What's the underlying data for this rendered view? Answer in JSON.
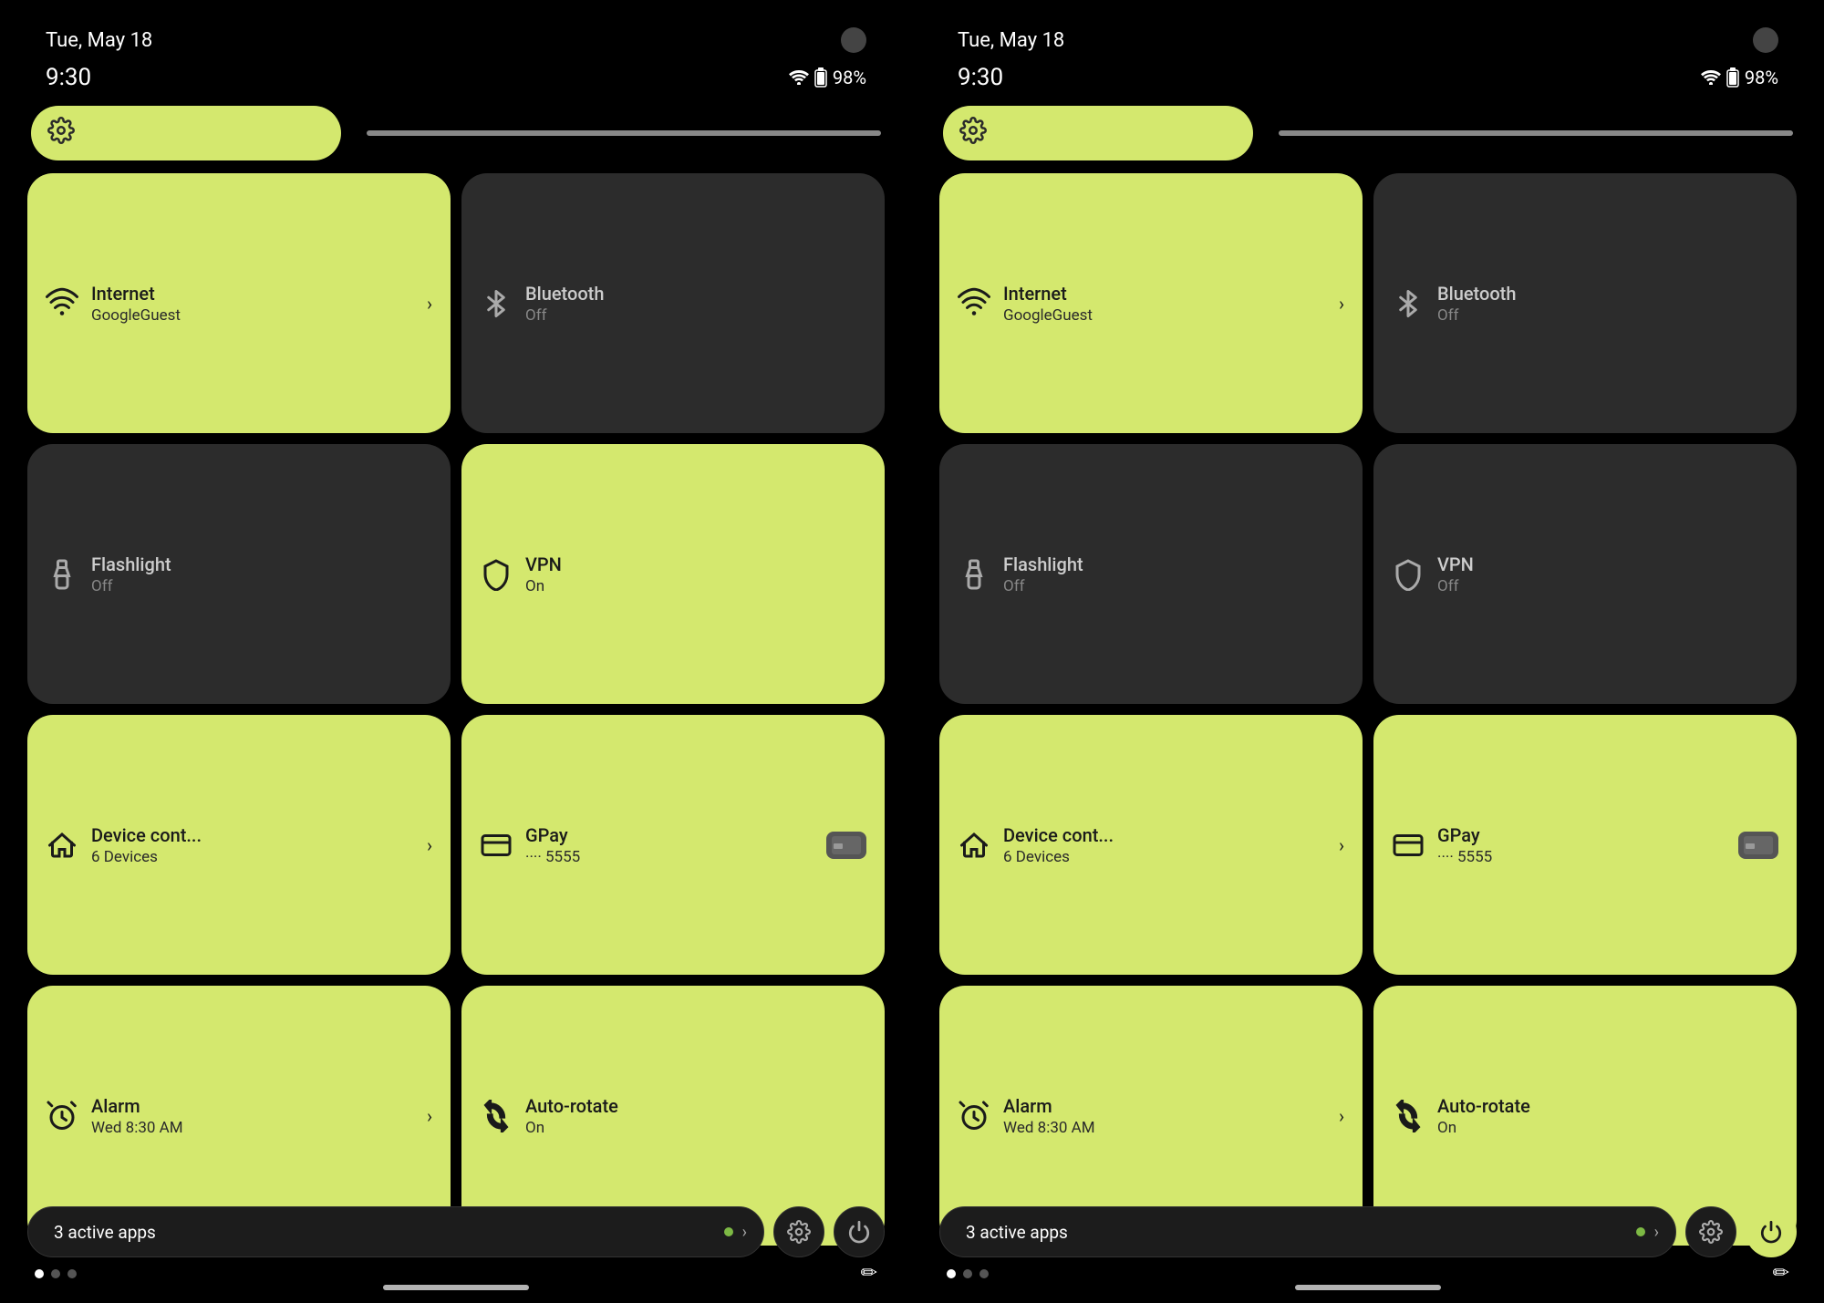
{
  "colors": {
    "active_tile": "#d4e86e",
    "inactive_tile": "#2c2c2c",
    "background": "#000000",
    "active_text": "#1a1a1a",
    "inactive_text_primary": "#cccccc",
    "inactive_text_secondary": "#888888"
  },
  "panels": [
    {
      "id": "left",
      "status_date": "Tue, May 18",
      "status_time": "9:30",
      "battery": "98%",
      "brightness_icon": "⚙",
      "tiles": [
        {
          "id": "internet",
          "active": true,
          "icon": "wifi",
          "title": "Internet",
          "subtitle": "GoogleGuest",
          "has_chevron": true
        },
        {
          "id": "bluetooth",
          "active": false,
          "icon": "bt",
          "title": "Bluetooth",
          "subtitle": "Off",
          "has_chevron": false
        },
        {
          "id": "flashlight",
          "active": false,
          "icon": "flashlight",
          "title": "Flashlight",
          "subtitle": "Off",
          "has_chevron": false
        },
        {
          "id": "vpn",
          "active": true,
          "icon": "vpn",
          "title": "VPN",
          "subtitle": "On",
          "has_chevron": false
        },
        {
          "id": "device",
          "active": true,
          "icon": "home",
          "title": "Device cont...",
          "subtitle": "6 Devices",
          "has_chevron": true
        },
        {
          "id": "gpay",
          "active": true,
          "icon": "card",
          "title": "GPay",
          "subtitle": "···· 5555",
          "has_card": true
        },
        {
          "id": "alarm",
          "active": true,
          "icon": "alarm",
          "title": "Alarm",
          "subtitle": "Wed 8:30 AM",
          "has_chevron": true
        },
        {
          "id": "autorotate",
          "active": true,
          "icon": "rotate",
          "title": "Auto-rotate",
          "subtitle": "On",
          "has_chevron": false
        }
      ],
      "active_apps_label": "3 active apps",
      "edit_icon": "✏",
      "dots": [
        true,
        false,
        false
      ],
      "power_active": false
    },
    {
      "id": "right",
      "status_date": "Tue, May 18",
      "status_time": "9:30",
      "battery": "98%",
      "brightness_icon": "⚙",
      "tiles": [
        {
          "id": "internet",
          "active": true,
          "icon": "wifi",
          "title": "Internet",
          "subtitle": "GoogleGuest",
          "has_chevron": true
        },
        {
          "id": "bluetooth",
          "active": false,
          "icon": "bt",
          "title": "Bluetooth",
          "subtitle": "Off",
          "has_chevron": false
        },
        {
          "id": "flashlight",
          "active": false,
          "icon": "flashlight",
          "title": "Flashlight",
          "subtitle": "Off",
          "has_chevron": false
        },
        {
          "id": "vpn",
          "active": false,
          "icon": "vpn",
          "title": "VPN",
          "subtitle": "Off",
          "has_chevron": false
        },
        {
          "id": "device",
          "active": true,
          "icon": "home",
          "title": "Device cont...",
          "subtitle": "6 Devices",
          "has_chevron": true
        },
        {
          "id": "gpay",
          "active": true,
          "icon": "card",
          "title": "GPay",
          "subtitle": "···· 5555",
          "has_card": true
        },
        {
          "id": "alarm",
          "active": true,
          "icon": "alarm",
          "title": "Alarm",
          "subtitle": "Wed 8:30 AM",
          "has_chevron": true
        },
        {
          "id": "autorotate",
          "active": true,
          "icon": "rotate",
          "title": "Auto-rotate",
          "subtitle": "On",
          "has_chevron": false
        }
      ],
      "active_apps_label": "3 active apps",
      "edit_icon": "✏",
      "dots": [
        true,
        false,
        false
      ],
      "power_active": true
    }
  ]
}
